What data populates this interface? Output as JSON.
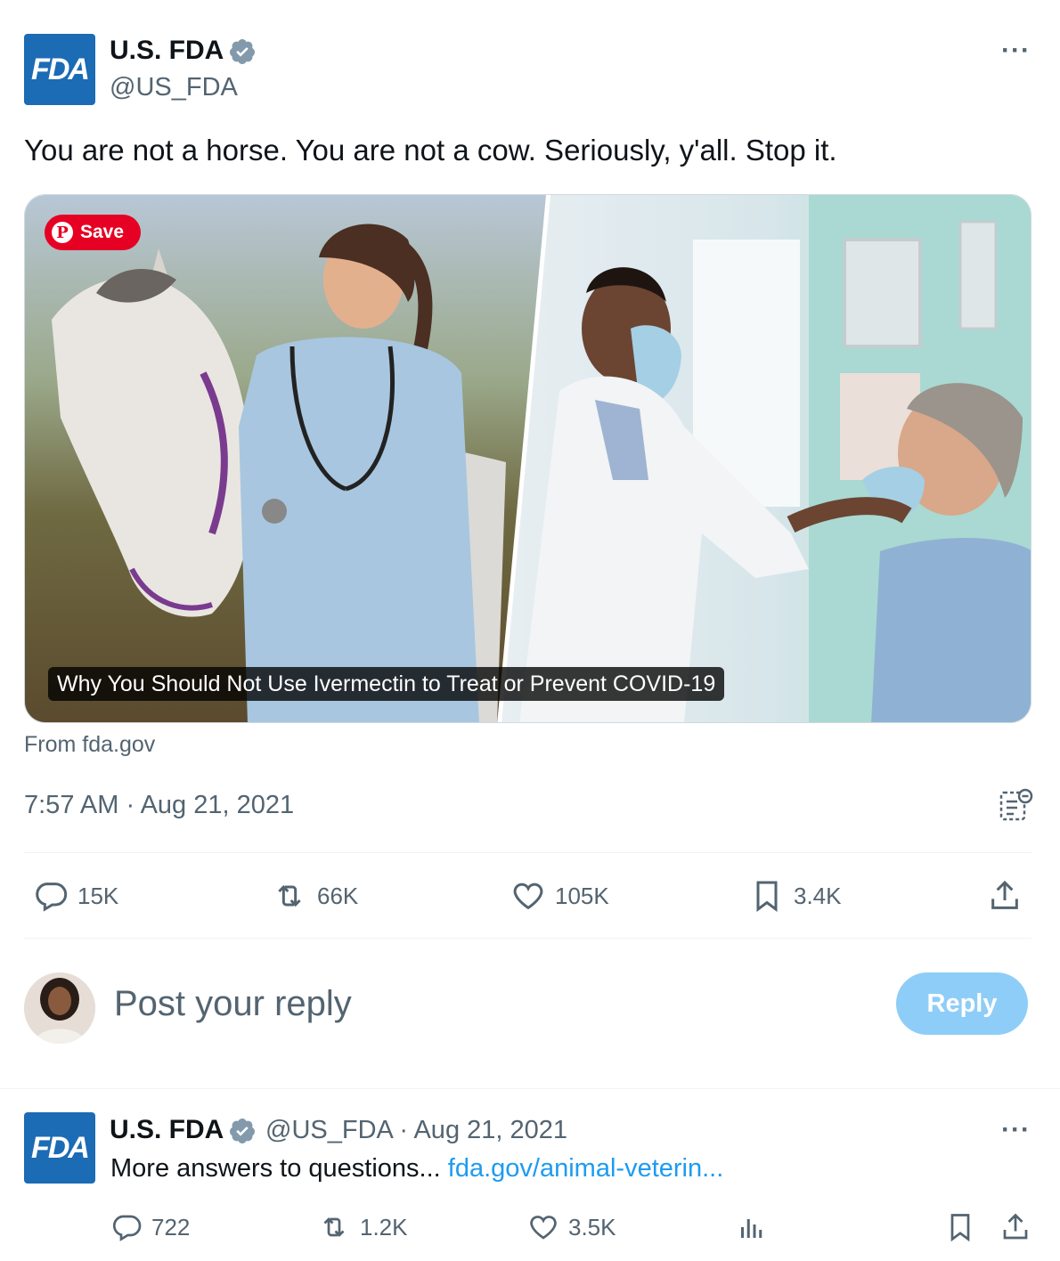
{
  "tweet": {
    "author_name": "U.S. FDA",
    "author_handle": "@US_FDA",
    "avatar_text": "FDA",
    "text": "You are not a horse. You are not a cow. Seriously, y'all. Stop it.",
    "media": {
      "save_label": "Save",
      "caption": "Why You Should Not Use Ivermectin to Treat or Prevent COVID-19"
    },
    "source": "From fda.gov",
    "timestamp": "7:57 AM · Aug 21, 2021",
    "stats": {
      "replies": "15K",
      "retweets": "66K",
      "likes": "105K",
      "bookmarks": "3.4K"
    }
  },
  "reply_box": {
    "placeholder": "Post your reply",
    "button_label": "Reply"
  },
  "thread_reply": {
    "author_name": "U.S. FDA",
    "author_handle": "@US_FDA",
    "separator": "·",
    "date": "Aug 21, 2021",
    "avatar_text": "FDA",
    "text": "More answers to questions... ",
    "link_text": "fda.gov/animal-veterin...",
    "stats": {
      "replies": "722",
      "retweets": "1.2K",
      "likes": "3.5K"
    }
  },
  "colors": {
    "fda_blue": "#1b6bb5",
    "verified_blue": "#1d9bf0",
    "link": "#1d9bf0",
    "pinterest_red": "#e60023",
    "reply_button": "#8ecdf8"
  },
  "icons": [
    "verified-badge-icon",
    "more-icon",
    "pinterest-icon",
    "views-icon",
    "reply-icon",
    "retweet-icon",
    "like-icon",
    "bookmark-icon",
    "share-icon",
    "analytics-icon"
  ]
}
